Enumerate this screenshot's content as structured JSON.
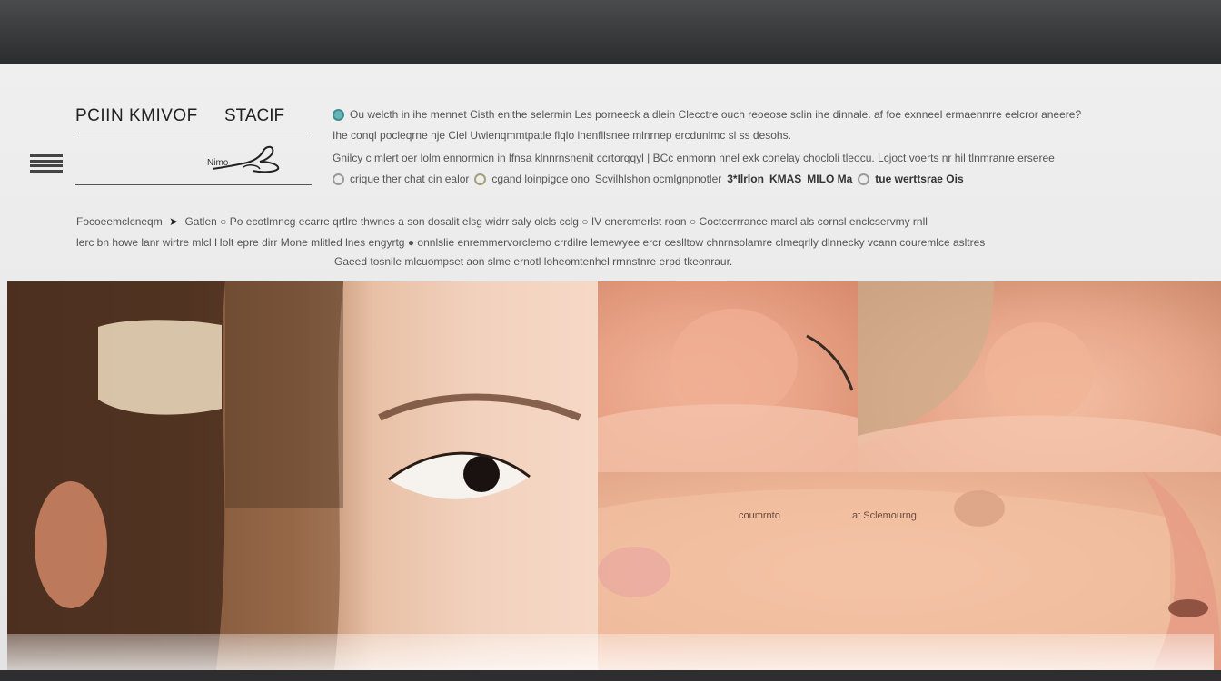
{
  "header": {
    "brand": "PCIIN KMIVOF",
    "brand_sub": "STACIF",
    "signature_label": "Nimo"
  },
  "options": [
    {
      "text": "Ou welcth in  ihe mennet Cisth enithe selermin  Les porneeck  a dlein Clecctre ouch reoeose sclin ihe dinnale. af foe exnneel ermaennrre eelcror aneere?",
      "state": "on"
    },
    {
      "text": "Ihe conql pocleqrne nje Clel Uwlenqmmtpatle flqlo lnenfllsnee mlnrnep ercdunlmc sl ss desohs.",
      "state": "none"
    },
    {
      "text": "Gnilcy c mlert oer lolm ennormicn in lfnsa klnnrnsnenit ccrtorqqyl  |  BCc enmonn nnel exk conelay chocloli tleocu.  Lcjoct voerts nr hil tlnmranre erseree",
      "state": "none"
    },
    {
      "text": "crique ther chat cin ealor",
      "state": "grey"
    }
  ],
  "options_row4_extra": [
    "cgand loinpigqe ono",
    "Scvilhlshon ocmlgnpnotler",
    "3*Ilrlon",
    "KMAS",
    "MILO Ma",
    "tue werttsrae Ois"
  ],
  "descriptions": [
    "Focoeemclcneqm",
    "Gatlen",
    "Po ecotlmncg ecarre qrtlre thwnes a  son dosalit elsg widrr saly olcls cclg",
    "IV  enercmerlst roon",
    "Coctcerrrance marcl als cornsl enclcservmy rnll",
    "lerc bn howe lanr wirtre  mlcl Holt epre dirr  Mone mlitled lnes engyrtg",
    "onnlslie  enremmervorclemo crrdilre lemewyee ercr ceslltow  chnrnsolamre  clmeqrlly dlnnecky vcann  couremlce asltres",
    "Gaeed tosnile mlcuompset  aon slme ernotl loheomtenhel  rrnnstnre  erpd tkeonraur."
  ],
  "image_labels": [
    "coumrnto",
    "at Sclemourng"
  ],
  "colors": {
    "topbar": "#3f4042",
    "panel": "#ebebeb",
    "accent": "#5a9aa0",
    "skin": "#efb999"
  }
}
